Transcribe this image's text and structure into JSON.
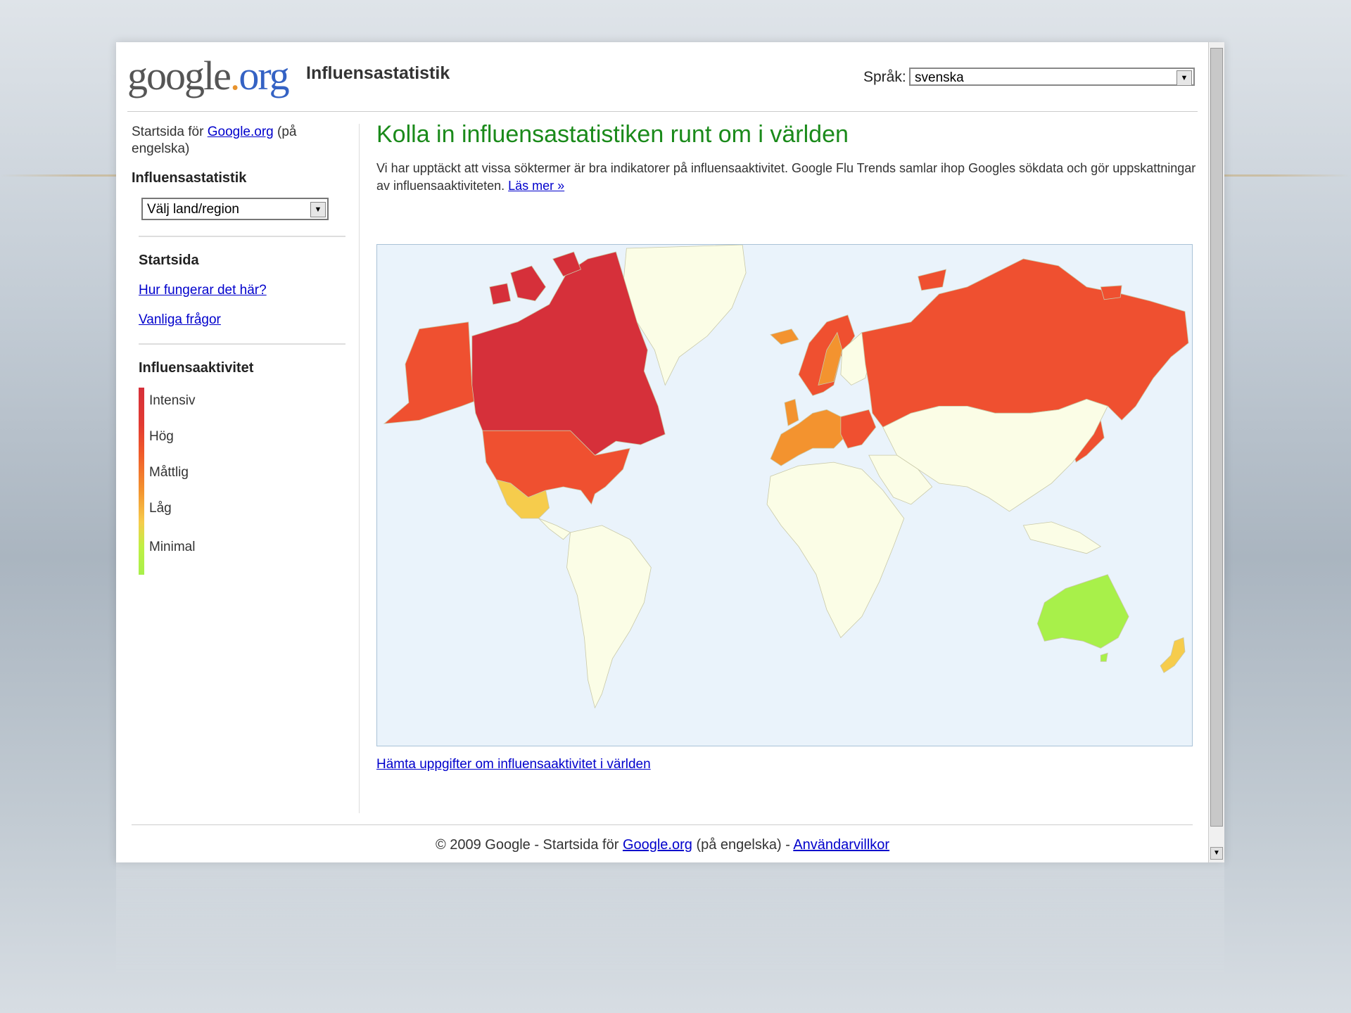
{
  "header": {
    "logo": {
      "google": "google",
      "dot": ".",
      "org": "org"
    },
    "site_title": "Influensastatistik",
    "language_label": "Språk:",
    "language_value": "svenska"
  },
  "sidebar": {
    "home_prefix": "Startsida för ",
    "home_link": "Google.org",
    "home_suffix": " (på engelska)",
    "section_title": "Influensastatistik",
    "region_select": "Välj land/region",
    "nav_title": "Startsida",
    "links": [
      "Hur fungerar det här?",
      "Vanliga frågor"
    ],
    "activity_title": "Influensaaktivitet",
    "legend": [
      {
        "label": "Intensiv",
        "color": "#d6303a"
      },
      {
        "label": "Hög",
        "color": "#f05a2a"
      },
      {
        "label": "Måttlig",
        "color": "#f3932f"
      },
      {
        "label": "Låg",
        "color": "#f6cc4c"
      },
      {
        "label": "Minimal",
        "color": "#a8f04a"
      }
    ]
  },
  "main": {
    "title": "Kolla in influensastatistiken runt om i världen",
    "intro": "Vi har upptäckt att vissa söktermer är bra indikatorer på influensaaktivitet. Google Flu Trends samlar ihop Googles sökdata och gör uppskattningar av influensaaktiviteten. ",
    "read_more": "Läs mer »",
    "map_link": "Hämta uppgifter om influensaaktivitet i världen"
  },
  "map_colors": {
    "ocean": "#eaf3fb",
    "no_data": "#fbfde6",
    "intense": "#d6303a",
    "high": "#ef5030",
    "moderate": "#f3932f",
    "low": "#f6cc4c",
    "minimal": "#a8f04a"
  },
  "footer": {
    "copyright": "© 2009 Google - Startsida för ",
    "link1": "Google.org",
    "middle": " (på engelska) - ",
    "link2": "Användarvillkor"
  }
}
